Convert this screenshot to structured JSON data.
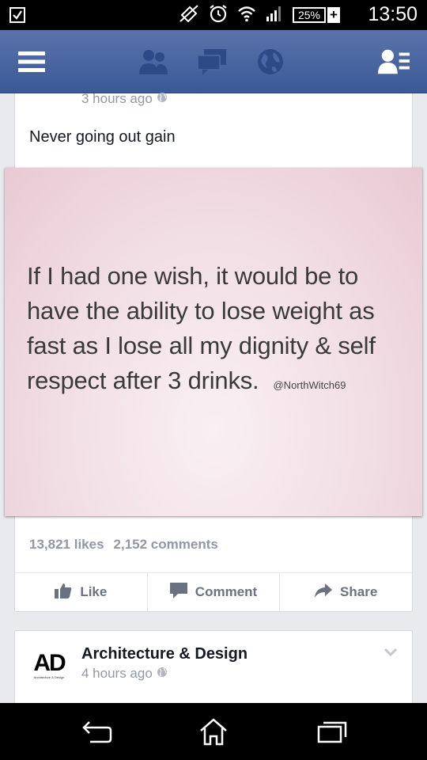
{
  "status_bar": {
    "battery": "25%",
    "battery_plus": "+",
    "time": "13:50"
  },
  "top_bar": {
    "color": "#3b5998",
    "icons": [
      "menu-icon",
      "friends-icon",
      "messages-icon",
      "globe-icon",
      "friend-list-icon"
    ]
  },
  "post": {
    "time": "3 hours ago",
    "text": "Never going out gain",
    "image_quote": "If I had one wish, it would be to have the ability to lose weight as fast as I lose all my dignity & self respect after 3 drinks.",
    "image_handle": "@NorthWitch69",
    "likes": "13,821 likes",
    "comments": "2,152 comments",
    "actions": {
      "like": "Like",
      "comment": "Comment",
      "share": "Share"
    }
  },
  "next_post": {
    "logo_text": "AD",
    "logo_subtext": "Architecture & Design",
    "page_name": "Architecture & Design",
    "time": "4 hours ago"
  },
  "nav_bar": {
    "icons": [
      "back-icon",
      "home-icon",
      "recent-apps-icon"
    ]
  }
}
